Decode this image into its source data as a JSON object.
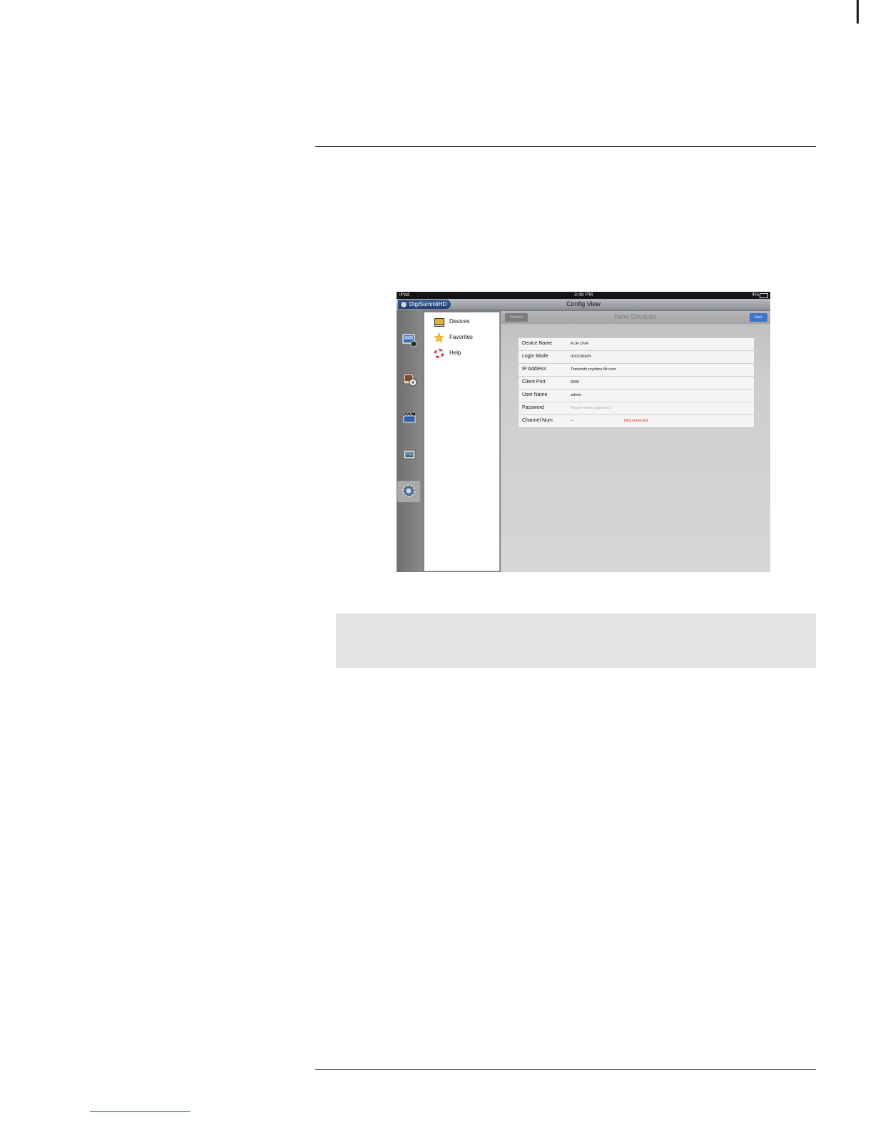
{
  "ipad_screen": {
    "status_bar": {
      "carrier": "iPad",
      "time": "3:48 PM",
      "battery": "4%"
    },
    "title_bar": {
      "title": "Config View",
      "app_tab": "DigiSummitHD"
    },
    "icon_bar": {
      "items": [
        {
          "icon": "live-view-icon"
        },
        {
          "icon": "playback-icon"
        },
        {
          "icon": "video-clips-icon"
        },
        {
          "icon": "snapshot-icon"
        },
        {
          "icon": "settings-gear-icon",
          "active": true
        }
      ]
    },
    "menu": {
      "items": [
        {
          "label": "Devices",
          "icon": "devices-icon"
        },
        {
          "label": "Favorites",
          "icon": "star-icon"
        },
        {
          "label": "Help",
          "icon": "help-lifebuoy-icon"
        }
      ]
    },
    "content": {
      "back_label": "Devices",
      "title": "New Devices",
      "save_label": "Save",
      "fields": [
        {
          "label": "Device Name",
          "value": "FLIR DVR"
        },
        {
          "label": "Login Mode",
          "value": "IP/DOMAIN"
        },
        {
          "label": "IP Address",
          "value": "Tomsmith.myddns-flir.com"
        },
        {
          "label": "Client Port",
          "value": "9000"
        },
        {
          "label": "User Name",
          "value": "admin"
        },
        {
          "label": "Password",
          "placeholder": "Please enter password"
        },
        {
          "label": "Channel Num",
          "value": "--",
          "status": "Disconnected"
        }
      ]
    },
    "colors": {
      "save_button": "#3e73c8",
      "status_disconnected": "#d22a1a",
      "app_tab": "#2b4a80"
    }
  }
}
